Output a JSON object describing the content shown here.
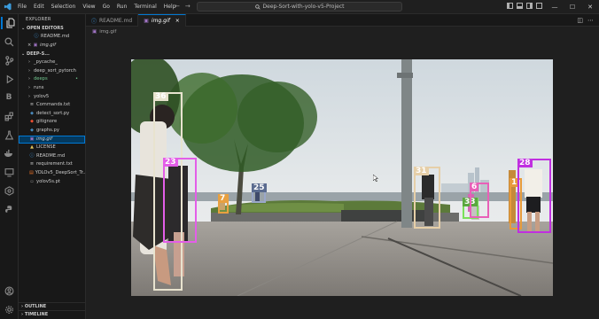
{
  "titlebar": {
    "menu": [
      "File",
      "Edit",
      "Selection",
      "View",
      "Go",
      "Run",
      "Terminal",
      "Help"
    ],
    "search_text": "Deep-Sort-with-yolo-v5-Project"
  },
  "sidebar": {
    "title": "EXPLORER",
    "open_editors_label": "OPEN EDITORS",
    "open_editors": [
      {
        "name": "README.md",
        "icon": "info-icon"
      },
      {
        "name": "img.gif",
        "icon": "image-icon",
        "close": "×"
      }
    ],
    "project_label": "DEEP-S...",
    "files": [
      {
        "name": "_pycache_",
        "kind": "folder",
        "color": "#cccccc"
      },
      {
        "name": "deep_sort_pytorch",
        "kind": "folder",
        "color": "#cccccc"
      },
      {
        "name": "deeps",
        "kind": "folder",
        "color": "#73c991",
        "badge": "•"
      },
      {
        "name": "runs",
        "kind": "folder",
        "color": "#cccccc"
      },
      {
        "name": "yolov5",
        "kind": "folder",
        "color": "#cccccc"
      },
      {
        "name": "Commands.txt",
        "kind": "text",
        "color": "#cccccc"
      },
      {
        "name": "detect_sort.py",
        "kind": "python",
        "color": "#cccccc"
      },
      {
        "name": "gitignore",
        "kind": "git",
        "color": "#cccccc"
      },
      {
        "name": "graphs.py",
        "kind": "python",
        "color": "#cccccc"
      },
      {
        "name": "img.gif",
        "kind": "image",
        "color": "#cccccc",
        "selected": true
      },
      {
        "name": "LICENSE",
        "kind": "license",
        "color": "#cccccc"
      },
      {
        "name": "README.md",
        "kind": "info",
        "color": "#cccccc"
      },
      {
        "name": "requirement.txt",
        "kind": "text",
        "color": "#cccccc"
      },
      {
        "name": "YOLOv5_DeepSort_Tr...",
        "kind": "notebook",
        "color": "#cccccc"
      },
      {
        "name": "yolov5s.pt",
        "kind": "file",
        "color": "#cccccc"
      }
    ],
    "outline_label": "OUTLINE",
    "timeline_label": "TIMELINE"
  },
  "tabs": [
    {
      "label": "README.md",
      "icon": "info-icon",
      "active": false
    },
    {
      "label": "img.gif",
      "icon": "image-icon",
      "active": true,
      "close": "×"
    }
  ],
  "breadcrumb": {
    "file": "img.gif"
  },
  "detections": [
    {
      "id": "36",
      "color": "#e8e3cf"
    },
    {
      "id": "23",
      "color": "#e35ee8"
    },
    {
      "id": "7",
      "color": "#e8a040"
    },
    {
      "id": "25",
      "color": "#9aa7c9"
    },
    {
      "id": "31",
      "color": "#e6cfa8"
    },
    {
      "id": "33",
      "color": "#7ae05a"
    },
    {
      "id": "6",
      "color": "#e860b8"
    },
    {
      "id": "1",
      "color": "#e89a3c"
    },
    {
      "id": "28",
      "color": "#c02fe0"
    }
  ]
}
